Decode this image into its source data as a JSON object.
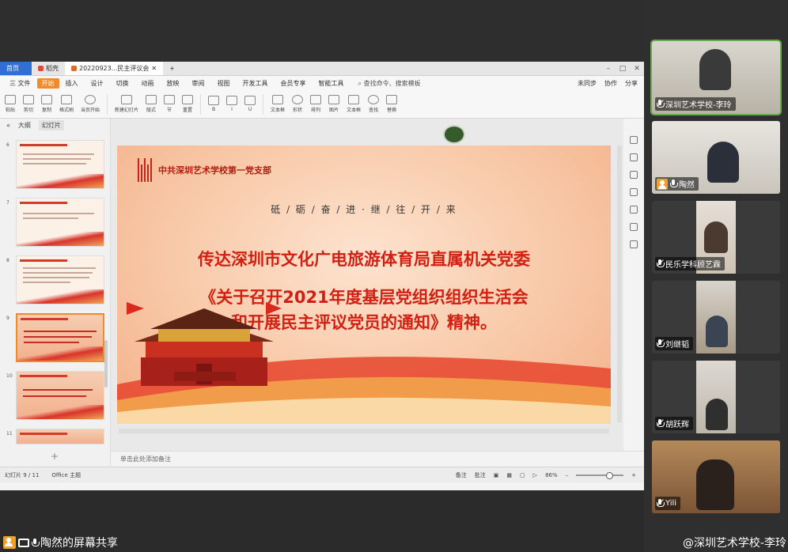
{
  "ppt": {
    "tabs": [
      "首页",
      "稻壳",
      "20220923...民主评议会"
    ],
    "menus": [
      "三 文件",
      "开始",
      "插入",
      "设计",
      "切换",
      "动画",
      "放映",
      "审阅",
      "视图",
      "开发工具",
      "会员专享",
      "智能工具",
      "查找命令、搜索模板"
    ],
    "menu_right": [
      "未同步",
      "协作",
      "分享"
    ],
    "ribbon_items": [
      "粘贴",
      "剪切",
      "复制",
      "格式刷",
      "当页开始",
      "新建幻灯片",
      "版式",
      "节",
      "重置",
      "文本框",
      "形状",
      "排列",
      "图片",
      "文本框",
      "查找",
      "替换"
    ],
    "panel_tabs": [
      "大纲",
      "幻灯片"
    ],
    "thumb_numbers": [
      "6",
      "7",
      "8",
      "9",
      "10",
      "11"
    ],
    "notes_placeholder": "单击此处添加备注",
    "status_slide": "幻灯片 9 / 11",
    "status_theme": "Office 主题",
    "status_notes": "备注",
    "status_comments": "批注",
    "zoom": "86%"
  },
  "slide": {
    "org": "中共深圳艺术学校第一党支部",
    "motto": "砥 / 砺 / 奋 / 进  ·  继 / 往 / 开 / 来",
    "line1": "传达深圳市文化广电旅游体育局直属机关党委",
    "line2": "《关于召开2021年度基层党组织组织生活会",
    "line3": "和开展民主评议党员的通知》精神。"
  },
  "participants": [
    {
      "name": "深圳艺术学校-李玲",
      "muted": true,
      "host": false
    },
    {
      "name": "陶然",
      "muted": false,
      "host": true
    },
    {
      "name": "民乐学科顾艺霖",
      "muted": true,
      "host": false
    },
    {
      "name": "刘继韬",
      "muted": true,
      "host": false
    },
    {
      "name": "胡跃辉",
      "muted": true,
      "host": false
    },
    {
      "name": "Yili",
      "muted": true,
      "host": false
    }
  ],
  "share_label": "陶然的屏幕共享",
  "active_speaker": "@深圳艺术学校-李玲"
}
